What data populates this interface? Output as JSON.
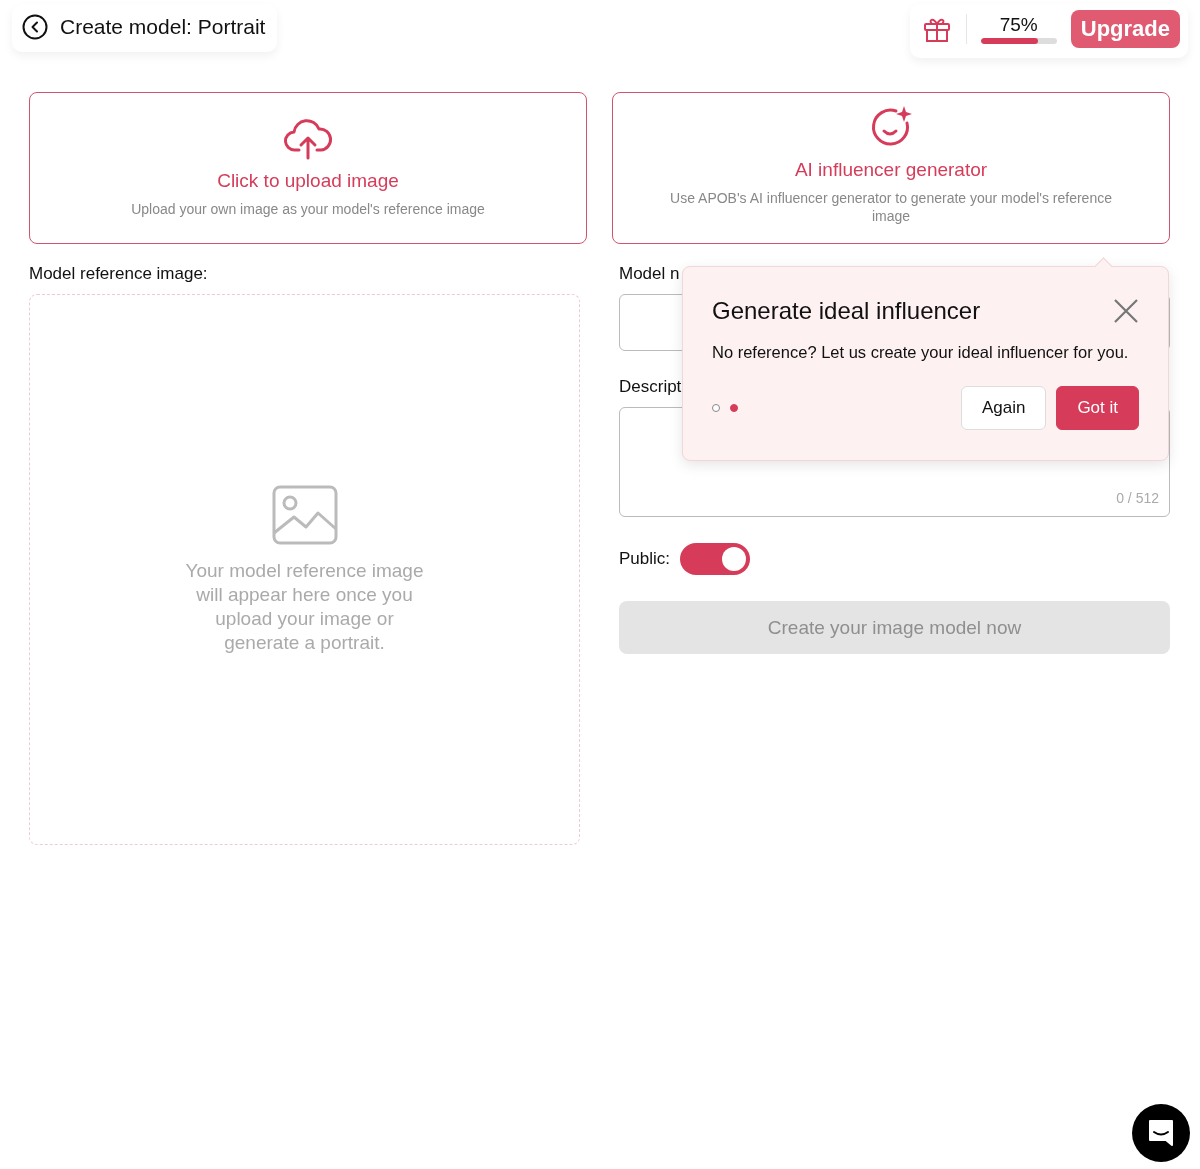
{
  "header": {
    "title": "Create model: Portrait",
    "progress": {
      "label": "75%",
      "level": 0.75
    },
    "upgrade_button": "Upgrade"
  },
  "source_cards": [
    {
      "kind": "upload",
      "title": "Click to upload image",
      "description": "Upload your own image as your model's reference image"
    },
    {
      "kind": "generator",
      "title": "AI influencer generator",
      "description": "Use APOB's AI influencer generator to generate your model's reference image"
    }
  ],
  "reference_panel": {
    "label": "Model reference image:",
    "empty_text": "Your model reference image will appear here once you upload your image or generate a portrait."
  },
  "form": {
    "name_label": "Model n",
    "description_label": "Descript",
    "description_counter": "0 / 512",
    "public_label": "Public:",
    "public_on": true,
    "submit_button": {
      "label": "Create your image model now",
      "disabled": true
    }
  },
  "popover": {
    "title": "Generate ideal influencer",
    "message": "No reference? Let us create your ideal influencer for you.",
    "steps": [
      {
        "selected": false
      },
      {
        "selected": true
      }
    ],
    "buttons": [
      {
        "kind": "secondary",
        "label": "Again"
      },
      {
        "kind": "primary",
        "label": "Got it"
      }
    ]
  }
}
